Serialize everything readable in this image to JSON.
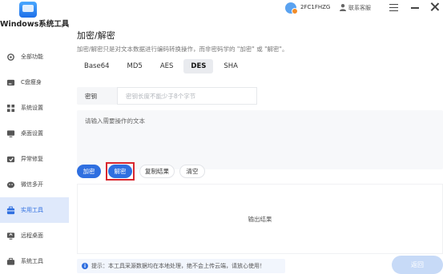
{
  "app": {
    "name": "Windows系统工具"
  },
  "sidebar": {
    "items": [
      {
        "label": "全部功能",
        "icon": "gear-icon",
        "active": false
      },
      {
        "label": "C盘瘦身",
        "icon": "disk-icon",
        "active": false
      },
      {
        "label": "系统设置",
        "icon": "grid-icon",
        "active": false
      },
      {
        "label": "桌面设置",
        "icon": "monitor-icon",
        "active": false
      },
      {
        "label": "异常修复",
        "icon": "wrench-icon",
        "active": false
      },
      {
        "label": "微信多开",
        "icon": "wechat-icon",
        "active": false
      },
      {
        "label": "实用工具",
        "icon": "toolbox-icon",
        "active": true
      },
      {
        "label": "远程桌面",
        "icon": "remote-icon",
        "active": false
      },
      {
        "label": "系统工具",
        "icon": "briefcase-icon",
        "active": false
      }
    ]
  },
  "topbar": {
    "user_id": "2FC1FHZG",
    "support_label": "联系客服"
  },
  "main": {
    "title": "加密/解密",
    "description": "加密/解密只是对文本数据进行编码转换操作，而非密码学的 \"加密\" 或 \"解密\"。",
    "tabs": [
      {
        "label": "Base64",
        "active": false
      },
      {
        "label": "MD5",
        "active": false
      },
      {
        "label": "AES",
        "active": false
      },
      {
        "label": "DES",
        "active": true
      },
      {
        "label": "SHA",
        "active": false
      }
    ],
    "key_label": "密钥",
    "key_placeholder": "密钥长度不能少于8个字节",
    "text_placeholder": "请输入需要操作的文本",
    "buttons": {
      "encrypt": "加密",
      "decrypt": "解密",
      "copy": "复制结果",
      "clear": "清空"
    },
    "output_placeholder": "输出结果",
    "tip": "提示：本工具采源数据均在本地处理，绝不会上传云端，请放心使用！",
    "back_label": "返回"
  },
  "colors": {
    "accent": "#2f6fe0",
    "highlight_border": "#d9272e",
    "active_nav_bg": "#dfe9fb"
  }
}
